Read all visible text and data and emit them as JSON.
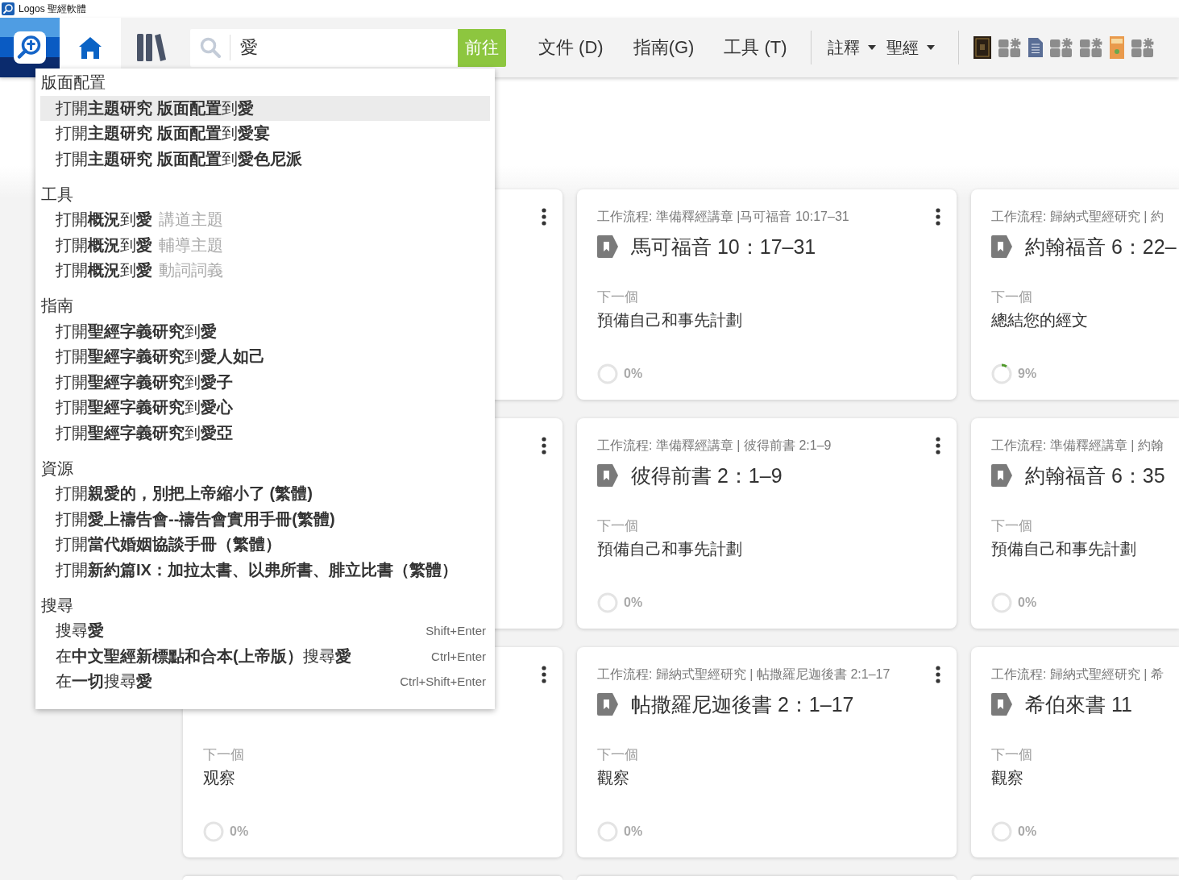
{
  "window": {
    "title": "Logos 聖經軟體"
  },
  "toolbar": {
    "search": {
      "value": "愛"
    },
    "go_button": "前往",
    "menus": [
      {
        "label": "文件 (D)",
        "kind": "plain"
      },
      {
        "label": "指南(G)",
        "kind": "plain"
      },
      {
        "label": "工具 (T)",
        "kind": "plain"
      },
      {
        "label": "註釋",
        "kind": "dropdown"
      },
      {
        "label": "聖經",
        "kind": "dropdown"
      }
    ],
    "shortcuts": [
      {
        "kind": "dark_book"
      },
      {
        "kind": "layout"
      },
      {
        "kind": "document"
      },
      {
        "kind": "layout"
      },
      {
        "kind": "layout"
      },
      {
        "kind": "orange_book"
      },
      {
        "kind": "layout"
      }
    ]
  },
  "search_menu": {
    "sections": [
      {
        "heading": "版面配置",
        "items": [
          {
            "text": "打開**主題研究 版面配置**到**愛**",
            "selected": true
          },
          {
            "text": "打開**主題研究 版面配置**到**愛宴**",
            "selected": false
          },
          {
            "text": "打開**主題研究 版面配置**到**愛色尼派**",
            "selected": false
          }
        ]
      },
      {
        "heading": "工具",
        "items": [
          {
            "text": "打開**概況**到**愛**",
            "detail": "講道主題",
            "selected": false
          },
          {
            "text": "打開**概況**到**愛**",
            "detail": "輔導主題",
            "selected": false
          },
          {
            "text": "打開**概況**到**愛**",
            "detail": "動詞詞義",
            "selected": false
          }
        ]
      },
      {
        "heading": "指南",
        "items": [
          {
            "text": "打開**聖經字義研究**到**愛**",
            "selected": false
          },
          {
            "text": "打開**聖經字義研究**到**愛人如己**",
            "selected": false
          },
          {
            "text": "打開**聖經字義研究**到**愛子**",
            "selected": false
          },
          {
            "text": "打開**聖經字義研究**到**愛心**",
            "selected": false
          },
          {
            "text": "打開**聖經字義研究**到**愛亞**",
            "selected": false
          }
        ]
      },
      {
        "heading": "資源",
        "items": [
          {
            "text": "打開**親愛的，別把上帝縮小了 (繁體)**",
            "selected": false
          },
          {
            "text": "打開**愛上禱告會--禱告會實用手冊(繁體)**",
            "selected": false
          },
          {
            "text": "打開**當代婚姻協談手冊（繁體）**",
            "selected": false
          },
          {
            "text": "打開**新約篇IX：加拉太書、以弗所書、腓立比書（繁體）**",
            "selected": false
          }
        ]
      },
      {
        "heading": "搜尋",
        "items": [
          {
            "text": "搜尋**愛**",
            "shortcut": "Shift+Enter",
            "selected": false
          },
          {
            "text": "在**中文聖經新標點和合本(上帝版）**搜尋**愛**",
            "shortcut": "Ctrl+Enter",
            "selected": false
          },
          {
            "text": "在**一切**搜尋**愛**",
            "shortcut": "Ctrl+Shift+Enter",
            "selected": false
          }
        ]
      }
    ]
  },
  "cards": [
    {
      "kind": "covered"
    },
    {
      "kind": "workflow",
      "workflow": "工作流程: 準備釋經講章 |马可福音 10:17–31",
      "title": "馬可福音 10：17–31",
      "next_label": "下一個",
      "next_step": "預備自己和事先計劃",
      "progress": {
        "reading": "0%"
      }
    },
    {
      "kind": "workflow",
      "workflow": "工作流程: 歸納式聖經研究 | 約",
      "title": "約翰福音 6：22–",
      "next_label": "下一個",
      "next_step": "總結您的經文",
      "progress": {
        "level": 0.09,
        "reading": "9%"
      }
    },
    {
      "kind": "covered"
    },
    {
      "kind": "workflow",
      "workflow": "工作流程: 準備釋經講章 | 彼得前書 2:1–9",
      "title": "彼得前書 2：1–9",
      "next_label": "下一個",
      "next_step": "預備自己和事先計劃",
      "progress": {
        "reading": "0%"
      }
    },
    {
      "kind": "workflow",
      "workflow": "工作流程: 準備釋經講章 | 約翰",
      "title": "約翰福音 6：35",
      "next_label": "下一個",
      "next_step": "預備自己和事先計劃",
      "progress": {
        "reading": "0%"
      }
    },
    {
      "kind": "workflow",
      "next_label": "下一個",
      "next_step": "观察",
      "progress": {
        "reading": "0%"
      }
    },
    {
      "kind": "workflow",
      "workflow": "工作流程: 歸納式聖經研究 | 帖撒羅尼迦後書 2:1–17",
      "title": "帖撒羅尼迦後書 2：1–17",
      "next_label": "下一個",
      "next_step": "觀察",
      "progress": {
        "reading": "0%"
      }
    },
    {
      "kind": "workflow",
      "workflow": "工作流程: 歸納式聖經研究 | 希",
      "title": "希伯來書 11",
      "next_label": "下一個",
      "next_step": "觀察",
      "progress": {
        "reading": "0%"
      }
    }
  ]
}
